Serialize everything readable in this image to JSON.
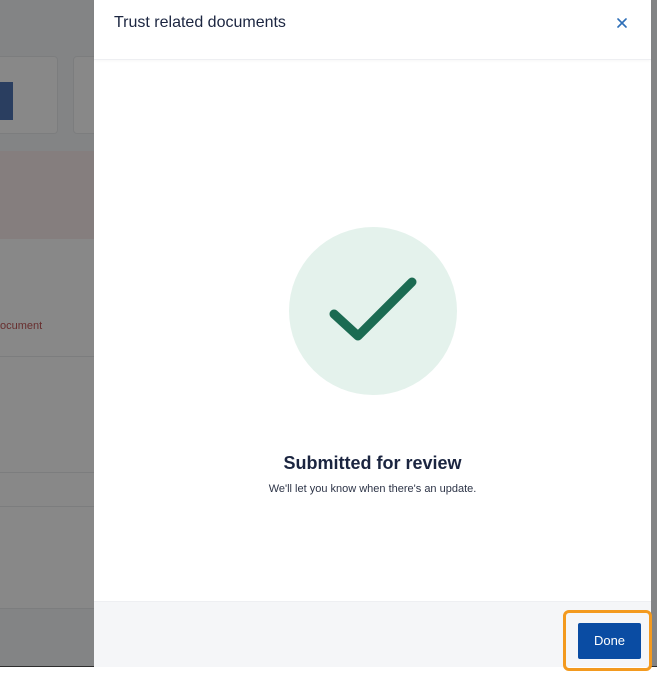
{
  "background": {
    "partial_link_text": "ocument"
  },
  "drawer": {
    "title": "Trust related documents",
    "close_icon": "close-icon",
    "success_icon": "checkmark-icon",
    "success_title": "Submitted for review",
    "success_subtitle": "We'll let you know when there's an update.",
    "done_label": "Done"
  },
  "colors": {
    "primary": "#0a4ca3",
    "success_check": "#1b6b52",
    "success_bg": "#e4f2ec",
    "highlight": "#f39a1f",
    "title_text": "#1b2540"
  }
}
